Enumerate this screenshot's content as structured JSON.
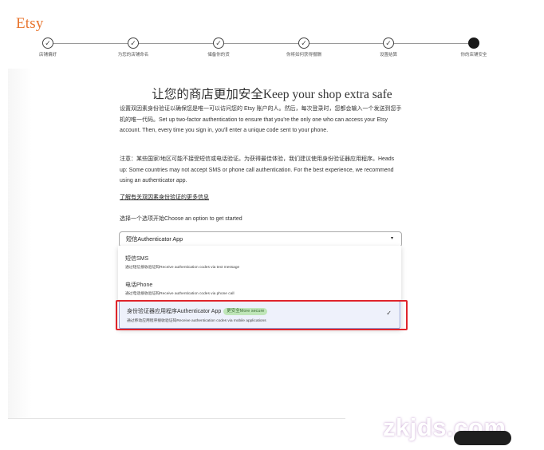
{
  "app": {
    "logo": "Etsy"
  },
  "stepper": {
    "steps": [
      {
        "label": "店铺偏好",
        "state": "done"
      },
      {
        "label": "为您的店铺命名",
        "state": "done"
      },
      {
        "label": "储备你的货",
        "state": "done"
      },
      {
        "label": "你将如何获得报酬",
        "state": "done"
      },
      {
        "label": "设置结算",
        "state": "done"
      },
      {
        "label": "你的店铺安全",
        "state": "current"
      }
    ]
  },
  "main": {
    "title": "让您的商店更加安全Keep your shop extra safe",
    "paragraph1": "设置双因素身份验证以确保您是唯一可以访问您的 Etsy 账户的人。然后，每次登录时，您都会输入一个发送到您手机的唯一代码。Set up two-factor authentication to ensure that you're the only one who can access your Etsy account. Then, every time you sign in, you'll enter a unique code sent to your phone.",
    "paragraph2": "注意：某些国家/地区可能不接受短信或电话验证。为获得最佳体验，我们建议使用身份验证器应用程序。Heads up: Some countries may not accept SMS or phone call authentication. For the best experience, we recommend using an authenticator app.",
    "learn_more": "了解有关双因素身份验证的更多信息",
    "prompt": "选择一个选项开始Choose an option to get started",
    "select": {
      "value": "短信Authenticator App",
      "caret": "▾"
    },
    "options": [
      {
        "title": "短信SMS",
        "desc": "通过短信接收验证码Receive authentication codes via text message"
      },
      {
        "title": "电话Phone",
        "desc": "通过电话接收验证码Receive authentication codes via phone call"
      },
      {
        "title": "身份验证器应用程序Authenticator App",
        "badge": "更安全More secure",
        "desc": "通过移动应用程序接收验证码Receive authentication codes via mobile applications",
        "check": "✓"
      }
    ]
  },
  "watermark": "zkjds.com",
  "colors": {
    "brand": "#e8742d",
    "highlight": "#e0242b",
    "badge_bg": "#bfe6b8"
  }
}
